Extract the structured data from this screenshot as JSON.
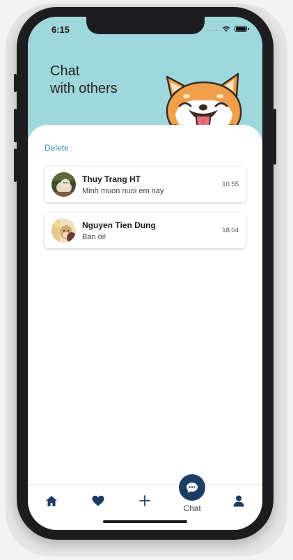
{
  "status": {
    "time": "6:15",
    "carrier_dots": "....."
  },
  "header": {
    "title_line1": "Chat",
    "title_line2": "with others"
  },
  "actions": {
    "delete_label": "Delete"
  },
  "chats": [
    {
      "name": "Thuy Trang HT",
      "message": "Minh muon nuoi em nay",
      "time": "10:55"
    },
    {
      "name": "Nguyen Tien Dung",
      "message": "Ban oi!",
      "time": "18:04"
    }
  ],
  "tabbar": {
    "items": [
      {
        "icon": "home-icon"
      },
      {
        "icon": "heart-icon"
      },
      {
        "icon": "plus-icon"
      },
      {
        "icon": "chat-icon",
        "label": "Chat",
        "active": true
      },
      {
        "icon": "user-icon"
      }
    ]
  },
  "colors": {
    "header_bg": "#9ed8dc",
    "accent_navy": "#1d3b63",
    "link_blue": "#3c8fb8",
    "mascot_orange": "#f0a04b"
  }
}
